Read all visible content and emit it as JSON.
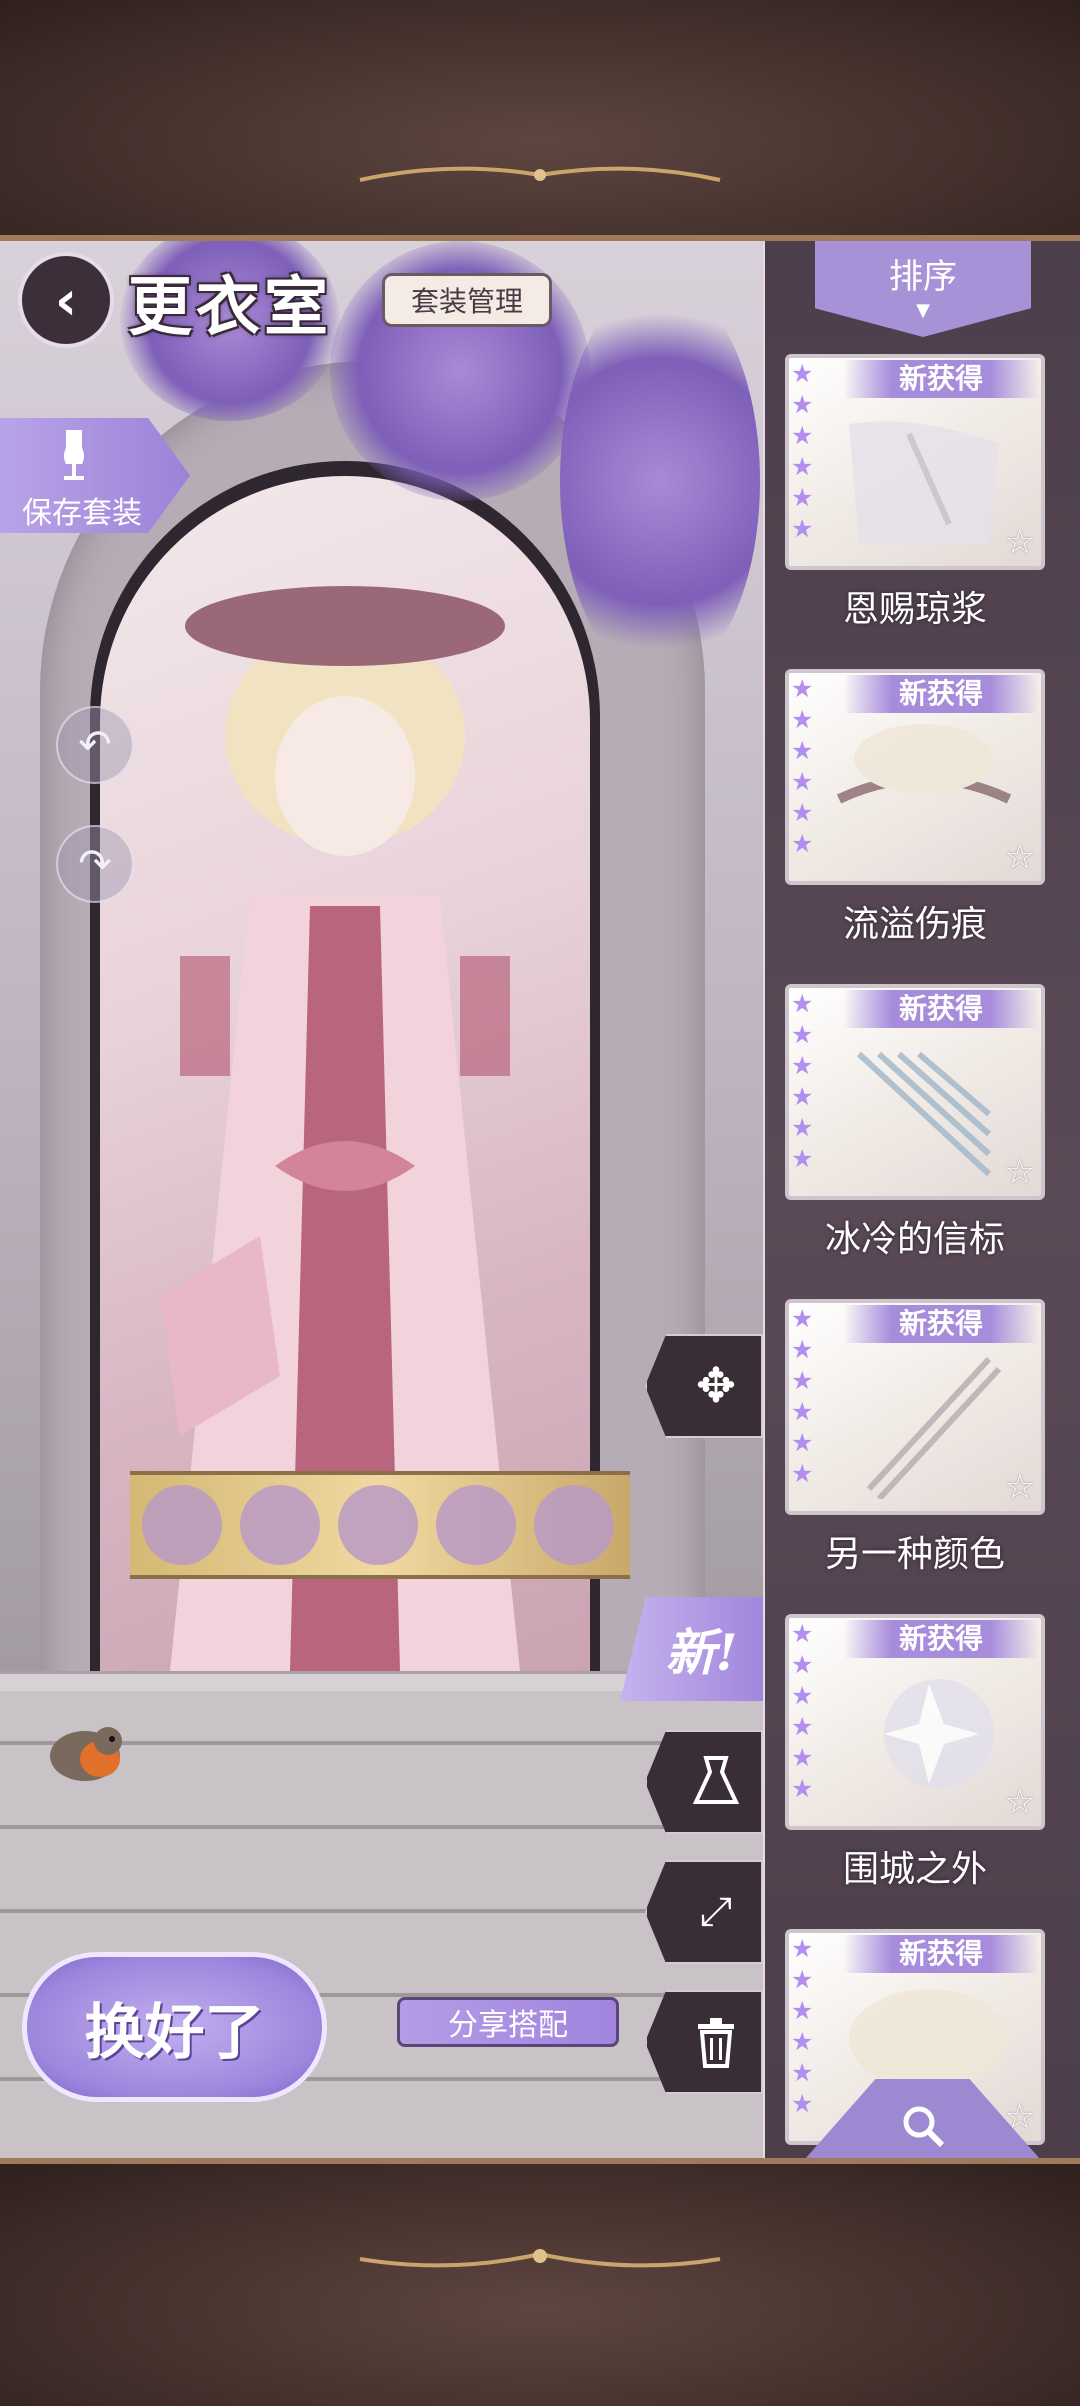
{
  "header": {
    "title": "更衣室",
    "suit_management_label": "套装管理"
  },
  "left_actions": {
    "save_suit_label": "保存套装"
  },
  "tools": {
    "new_label": "新!"
  },
  "bottom": {
    "done_label": "换好了",
    "share_label": "分享搭配"
  },
  "sidebar": {
    "sort_label": "排序",
    "new_badge": "新获得",
    "items": [
      {
        "name": "恩赐琼浆",
        "stars": 6
      },
      {
        "name": "流溢伤痕",
        "stars": 6
      },
      {
        "name": "冰冷的信标",
        "stars": 6
      },
      {
        "name": "另一种颜色",
        "stars": 6
      },
      {
        "name": "围城之外",
        "stars": 6
      },
      {
        "name": "",
        "stars": 6
      }
    ]
  },
  "colors": {
    "accent": "#a78cdc",
    "frame": "#4a3530",
    "sidebar": "#4d3e4b"
  },
  "icons": [
    "chevron-left-icon",
    "mannequin-save-icon",
    "undo-icon",
    "redo-icon",
    "move-icon",
    "dress-icon",
    "fullscreen-icon",
    "trash-icon",
    "search-icon",
    "star-icon"
  ]
}
